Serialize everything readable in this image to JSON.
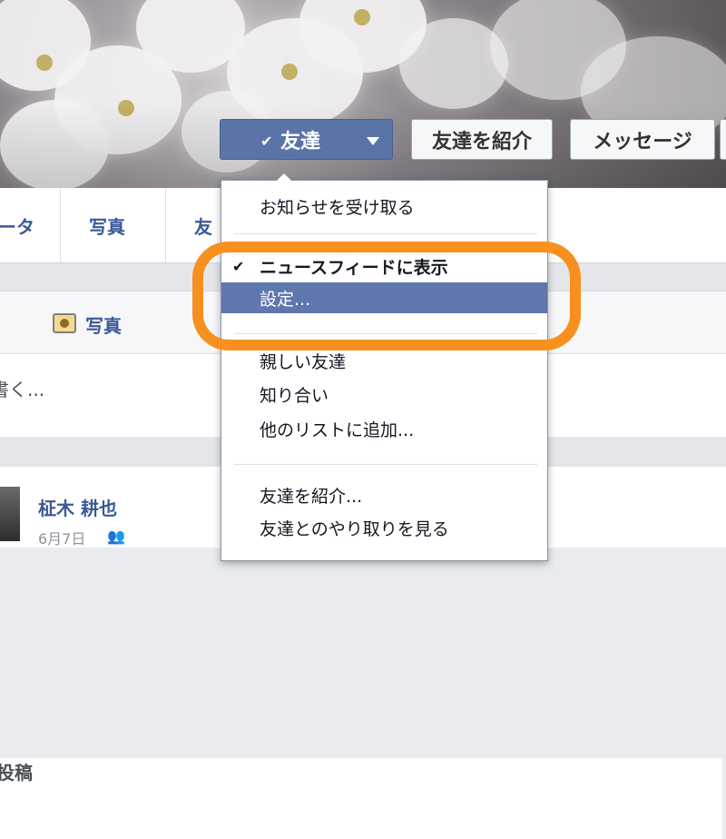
{
  "profile": {
    "friend_button_label": "友達",
    "recommend_button_label": "友達を紹介",
    "message_button_label": "メッセージ"
  },
  "tabs": [
    {
      "label": "ータ"
    },
    {
      "label": "写真"
    },
    {
      "label": "友"
    }
  ],
  "composer": {
    "post_tab_label": "投稿",
    "photo_tab_label": "写真",
    "input_placeholder": "書く..."
  },
  "post": {
    "author": "柾木 耕也",
    "date": "6月7日"
  },
  "friend_menu": {
    "items": [
      {
        "label": "お知らせを受け取る",
        "checked": false,
        "highlighted": false
      },
      {
        "label": "ニュースフィードに表示",
        "checked": true,
        "highlighted": false
      },
      {
        "label": "設定...",
        "checked": false,
        "highlighted": true
      },
      {
        "label": "親しい友達",
        "checked": false,
        "highlighted": false
      },
      {
        "label": "知り合い",
        "checked": false,
        "highlighted": false
      },
      {
        "label": "他のリストに追加...",
        "checked": false,
        "highlighted": false
      },
      {
        "label": "友達を紹介...",
        "checked": false,
        "highlighted": false
      },
      {
        "label": "友達とのやり取りを見る",
        "checked": false,
        "highlighted": false
      }
    ]
  },
  "colors": {
    "primary_blue": "#5b74a8",
    "link_blue": "#3b5998",
    "menu_highlight": "#5f77ac",
    "annotation_orange": "#f7901e"
  },
  "icons": {
    "check": "check-icon",
    "dropdown_caret": "caret-down-icon",
    "photo": "photo-icon",
    "friends": "friends-icon"
  }
}
